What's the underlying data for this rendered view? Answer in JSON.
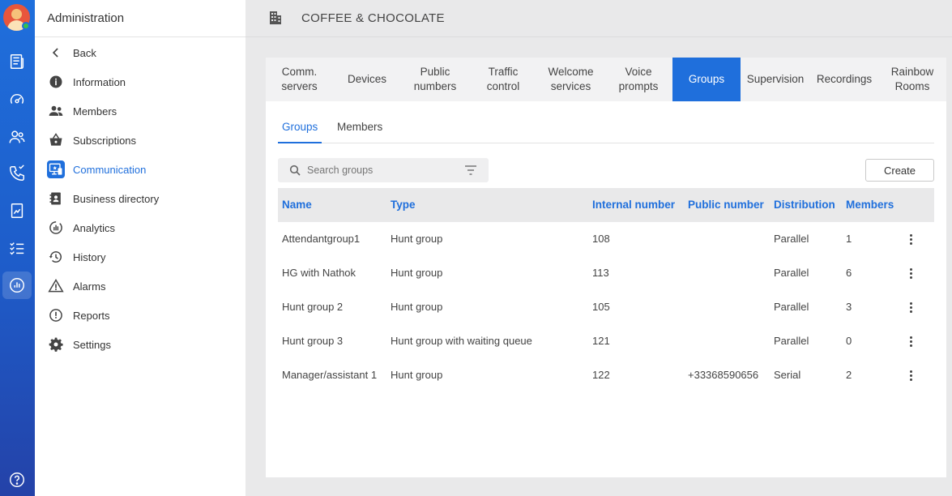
{
  "sidebar": {
    "title": "Administration",
    "items": [
      {
        "label": "Back"
      },
      {
        "label": "Information"
      },
      {
        "label": "Members"
      },
      {
        "label": "Subscriptions"
      },
      {
        "label": "Communication"
      },
      {
        "label": "Business directory"
      },
      {
        "label": "Analytics"
      },
      {
        "label": "History"
      },
      {
        "label": "Alarms"
      },
      {
        "label": "Reports"
      },
      {
        "label": "Settings"
      }
    ]
  },
  "header": {
    "company": "COFFEE & CHOCOLATE"
  },
  "tabs": [
    {
      "label": "Comm.\nservers"
    },
    {
      "label": "Devices"
    },
    {
      "label": "Public\nnumbers"
    },
    {
      "label": "Traffic\ncontrol"
    },
    {
      "label": "Welcome\nservices"
    },
    {
      "label": "Voice\nprompts"
    },
    {
      "label": "Groups"
    },
    {
      "label": "Supervision"
    },
    {
      "label": "Recordings"
    },
    {
      "label": "Rainbow\nRooms"
    }
  ],
  "subtabs": [
    {
      "label": "Groups"
    },
    {
      "label": "Members"
    }
  ],
  "search": {
    "placeholder": "Search groups"
  },
  "create_label": "Create",
  "table": {
    "headers": [
      "Name",
      "Type",
      "Internal number",
      "Public number",
      "Distribution",
      "Members"
    ],
    "rows": [
      [
        "Attendantgroup1",
        "Hunt group",
        "108",
        "",
        "Parallel",
        "1"
      ],
      [
        "HG with Nathok",
        "Hunt group",
        "113",
        "",
        "Parallel",
        "6"
      ],
      [
        "Hunt group 2",
        "Hunt group",
        "105",
        "",
        "Parallel",
        "3"
      ],
      [
        "Hunt group 3",
        "Hunt group with waiting queue",
        "121",
        "",
        "Parallel",
        "0"
      ],
      [
        "Manager/assistant 1",
        "Hunt group",
        "122",
        "+33368590656",
        "Serial",
        "2"
      ]
    ]
  }
}
